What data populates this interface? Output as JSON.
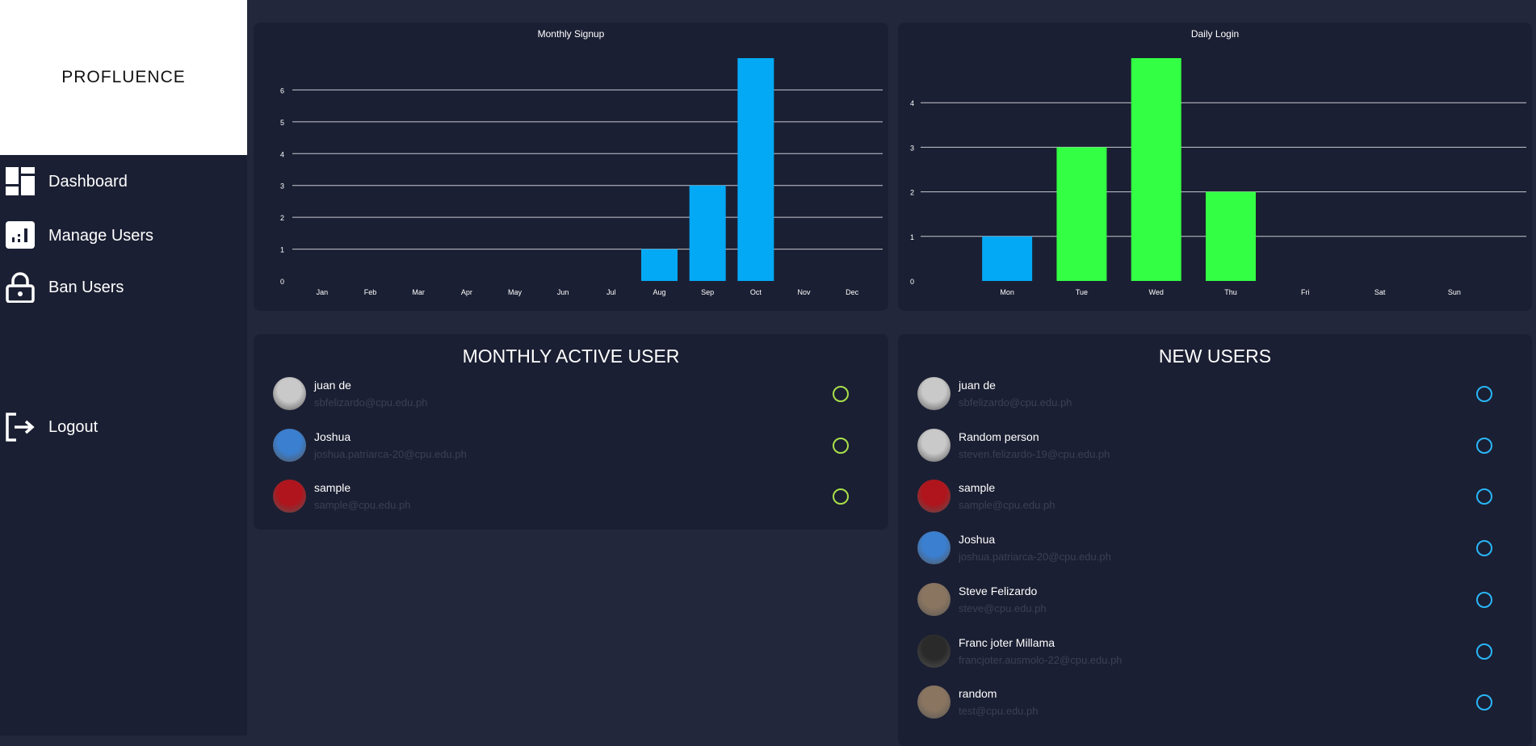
{
  "brand": "PROFLUENCE",
  "nav": [
    {
      "label": "Dashboard",
      "icon": "dashboard-icon"
    },
    {
      "label": "Manage Users",
      "icon": "chart-icon"
    },
    {
      "label": "Ban Users",
      "icon": "lock-icon"
    },
    {
      "label": "Logout",
      "icon": "logout-icon"
    }
  ],
  "colors": {
    "blue": "#03a9f4",
    "green": "#33ff44",
    "active": "#a8e04a",
    "new": "#29b6f6"
  },
  "chart_data": [
    {
      "type": "bar",
      "title": "Monthly Signup",
      "categories": [
        "Jan",
        "Feb",
        "Mar",
        "Apr",
        "May",
        "Jun",
        "Jul",
        "Aug",
        "Sep",
        "Oct",
        "Nov",
        "Dec"
      ],
      "values": [
        0,
        0,
        0,
        0,
        0,
        0,
        0,
        1,
        3,
        7,
        0,
        0
      ],
      "bar_colors": [
        "#03a9f4",
        "#03a9f4",
        "#03a9f4",
        "#03a9f4",
        "#03a9f4",
        "#03a9f4",
        "#03a9f4",
        "#03a9f4",
        "#03a9f4",
        "#03a9f4",
        "#03a9f4",
        "#03a9f4"
      ],
      "yticks": [
        0,
        1,
        2,
        3,
        4,
        5,
        6
      ],
      "ylim": [
        0,
        7
      ],
      "grid": true
    },
    {
      "type": "bar",
      "title": "Daily Login",
      "categories": [
        "Mon",
        "Tue",
        "Wed",
        "Thu",
        "Fri",
        "Sat",
        "Sun"
      ],
      "values": [
        1,
        3,
        5,
        2,
        0,
        0,
        0
      ],
      "bar_colors": [
        "#03a9f4",
        "#33ff44",
        "#33ff44",
        "#33ff44",
        "#33ff44",
        "#33ff44",
        "#33ff44"
      ],
      "yticks": [
        0,
        1,
        2,
        3,
        4
      ],
      "ylim": [
        0,
        5
      ],
      "grid": true
    }
  ],
  "monthly_active": {
    "title": "MONTHLY ACTIVE USER",
    "users": [
      {
        "name": "juan de",
        "email": "sbfelizardo@cpu.edu.ph",
        "avatar": "#c9c9c9"
      },
      {
        "name": "Joshua",
        "email": "joshua.patriarca-20@cpu.edu.ph",
        "avatar": "#3b7fd0"
      },
      {
        "name": "sample",
        "email": "sample@cpu.edu.ph",
        "avatar": "#b0141c"
      }
    ]
  },
  "new_users": {
    "title": "NEW USERS",
    "users": [
      {
        "name": "juan de",
        "email": "sbfelizardo@cpu.edu.ph",
        "avatar": "#c9c9c9"
      },
      {
        "name": "Random person",
        "email": "steven.felizardo-19@cpu.edu.ph",
        "avatar": "#c9c9c9"
      },
      {
        "name": "sample",
        "email": "sample@cpu.edu.ph",
        "avatar": "#b0141c"
      },
      {
        "name": "Joshua",
        "email": "joshua.patriarca-20@cpu.edu.ph",
        "avatar": "#3b7fd0"
      },
      {
        "name": "Steve Felizardo",
        "email": "steve@cpu.edu.ph",
        "avatar": "#8a7560"
      },
      {
        "name": "Franc joter Millama",
        "email": "francjoter.ausmolo-22@cpu.edu.ph",
        "avatar": "#2a2a2a"
      },
      {
        "name": "random",
        "email": "test@cpu.edu.ph",
        "avatar": "#8a7560"
      }
    ]
  }
}
